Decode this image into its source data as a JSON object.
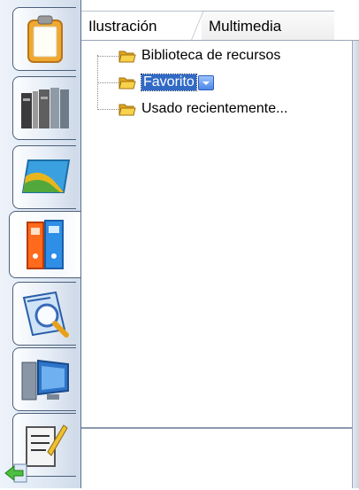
{
  "tabs": [
    {
      "label": "Ilustración",
      "active": true
    },
    {
      "label": "Multimedia",
      "active": false
    }
  ],
  "sidebar": {
    "items": [
      {
        "icon": "clipboard-icon",
        "active": false
      },
      {
        "icon": "library-books-icon",
        "active": false
      },
      {
        "icon": "landscape-card-icon",
        "active": false
      },
      {
        "icon": "binders-icon",
        "active": true
      },
      {
        "icon": "magnifier-search-icon",
        "active": false
      },
      {
        "icon": "computer-monitor-icon",
        "active": false
      },
      {
        "icon": "notepad-pen-icon",
        "active": false
      }
    ],
    "back_icon": "green-left-arrow-icon"
  },
  "tree": {
    "items": [
      {
        "label": "Biblioteca de recursos",
        "icon": "folder-icon",
        "selected": false
      },
      {
        "label": "Favorito",
        "icon": "folder-icon",
        "selected": true
      },
      {
        "label": "Usado recientemente...",
        "icon": "folder-icon",
        "selected": false
      }
    ]
  },
  "colors": {
    "selection": "#316ac5",
    "sidebar_border": "#4c5f7a",
    "folder": "#f2c230"
  }
}
